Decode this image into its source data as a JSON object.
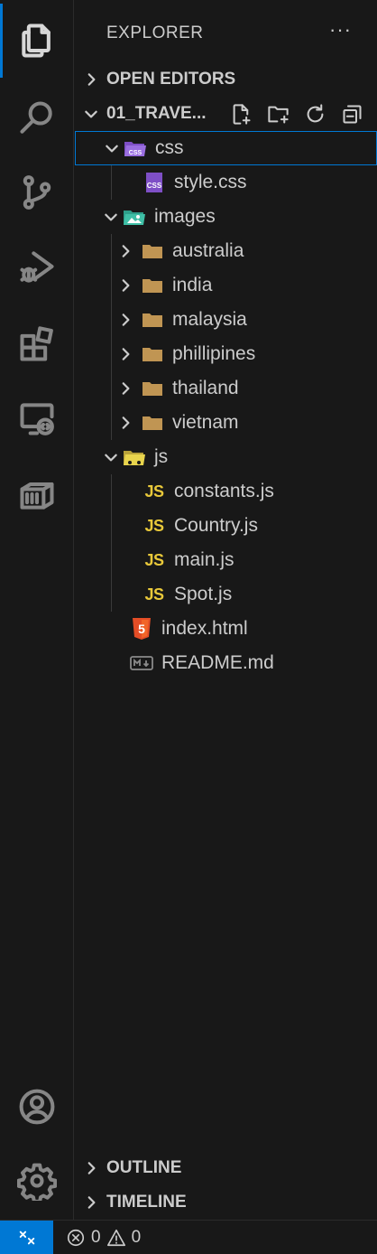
{
  "explorer": {
    "title": "EXPLORER",
    "more_label": "···",
    "open_editors_label": "OPEN EDITORS",
    "workspace_label": "01_TRAVE...",
    "tree": {
      "css": "css",
      "style_css": "style.css",
      "images": "images",
      "australia": "australia",
      "india": "india",
      "malaysia": "malaysia",
      "phillipines": "phillipines",
      "thailand": "thailand",
      "vietnam": "vietnam",
      "js": "js",
      "constants_js": "constants.js",
      "country_js": "Country.js",
      "main_js": "main.js",
      "spot_js": "Spot.js",
      "index_html": "index.html",
      "readme_md": "README.md"
    },
    "js_badge": "JS",
    "outline_label": "OUTLINE",
    "timeline_label": "TIMELINE"
  },
  "status_bar": {
    "errors": "0",
    "warnings": "0"
  },
  "colors": {
    "accent": "#0078d4",
    "folder": "#c09553",
    "js": "#e8c83a",
    "css": "#7e4fc6",
    "html": "#e44d26"
  }
}
